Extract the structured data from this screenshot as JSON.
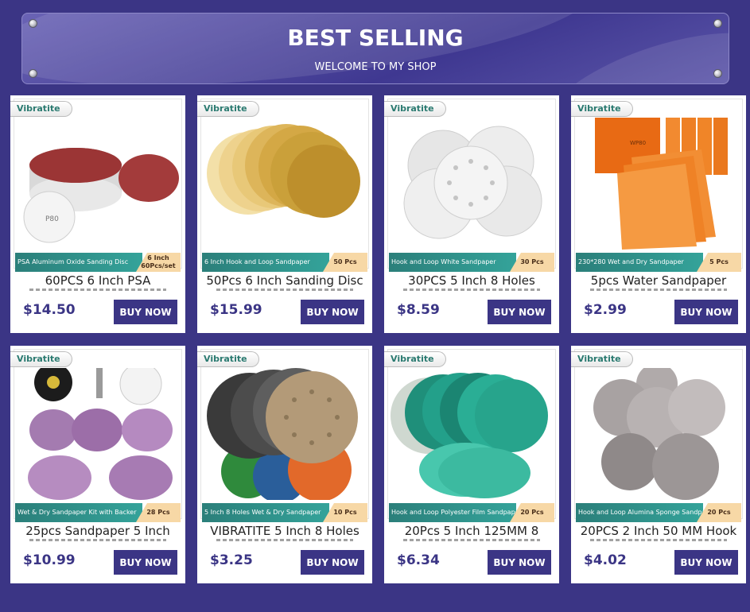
{
  "banner": {
    "title": "BEST SELLING",
    "subtitle": "WELCOME TO MY SHOP"
  },
  "products": [
    {
      "brand": "Vibratite",
      "ribbon_text": "PSA Aluminum Oxide Sanding Disc",
      "ribbon_count": "6 Inch 60Pcs/set",
      "title": "60PCS 6 Inch PSA",
      "price": "$14.50",
      "button": "BUY NOW",
      "colors": [
        "#8c2a2a",
        "#b34848",
        "#f0f0f0"
      ]
    },
    {
      "brand": "Vibratite",
      "ribbon_text": "6 Inch Hook and Loop Sandpaper",
      "ribbon_count": "50 Pcs",
      "title": "50Pcs 6 Inch Sanding Disc",
      "price": "$15.99",
      "button": "BUY NOW",
      "colors": [
        "#c99a2e",
        "#e7c878",
        "#f1dca2"
      ]
    },
    {
      "brand": "Vibratite",
      "ribbon_text": "Hook and Loop White Sandpaper",
      "ribbon_count": "30 Pcs",
      "title": "30PCS 5 Inch 8 Holes",
      "price": "$8.59",
      "button": "BUY NOW",
      "colors": [
        "#e3e3e3",
        "#f2f2f2",
        "#cfcfcf"
      ]
    },
    {
      "brand": "Vibratite",
      "ribbon_text": "230*280 Wet and Dry Sandpaper",
      "ribbon_count": "5 Pcs",
      "title": "5pcs Water Sandpaper",
      "price": "$2.99",
      "button": "BUY NOW",
      "colors": [
        "#f07a1c",
        "#f58f2f",
        "#e06410"
      ]
    },
    {
      "brand": "Vibratite",
      "ribbon_text": "Wet & Dry Sandpaper Kit with Backer",
      "ribbon_count": "28 Pcs",
      "title": "25pcs Sandpaper 5 Inch",
      "price": "$10.99",
      "button": "BUY NOW",
      "colors": [
        "#9c6aa8",
        "#b488bd",
        "#222222"
      ]
    },
    {
      "brand": "Vibratite",
      "ribbon_text": "5 Inch 8 Holes Wet & Dry Sandpaper",
      "ribbon_count": "10 Pcs",
      "title": "VIBRATITE 5 Inch 8 Holes",
      "price": "$3.25",
      "button": "BUY NOW",
      "colors": [
        "#3a3a3a",
        "#b89c78",
        "#e06a2a"
      ]
    },
    {
      "brand": "Vibratite",
      "ribbon_text": "Hook and Loop Polyester Film Sandpaper",
      "ribbon_count": "20 Pcs",
      "title": "20Pcs 5 Inch 125MM 8",
      "price": "$6.34",
      "button": "BUY NOW",
      "colors": [
        "#1f9c86",
        "#2bb79c",
        "#47c7ad"
      ]
    },
    {
      "brand": "Vibratite",
      "ribbon_text": "Hook and Loop Alumina Sponge Sandpaper",
      "ribbon_count": "20 Pcs",
      "title": "20PCS 2 Inch 50 MM Hook",
      "price": "$4.02",
      "button": "BUY NOW",
      "colors": [
        "#9a9595",
        "#bdb8b8",
        "#7d7878"
      ]
    }
  ]
}
